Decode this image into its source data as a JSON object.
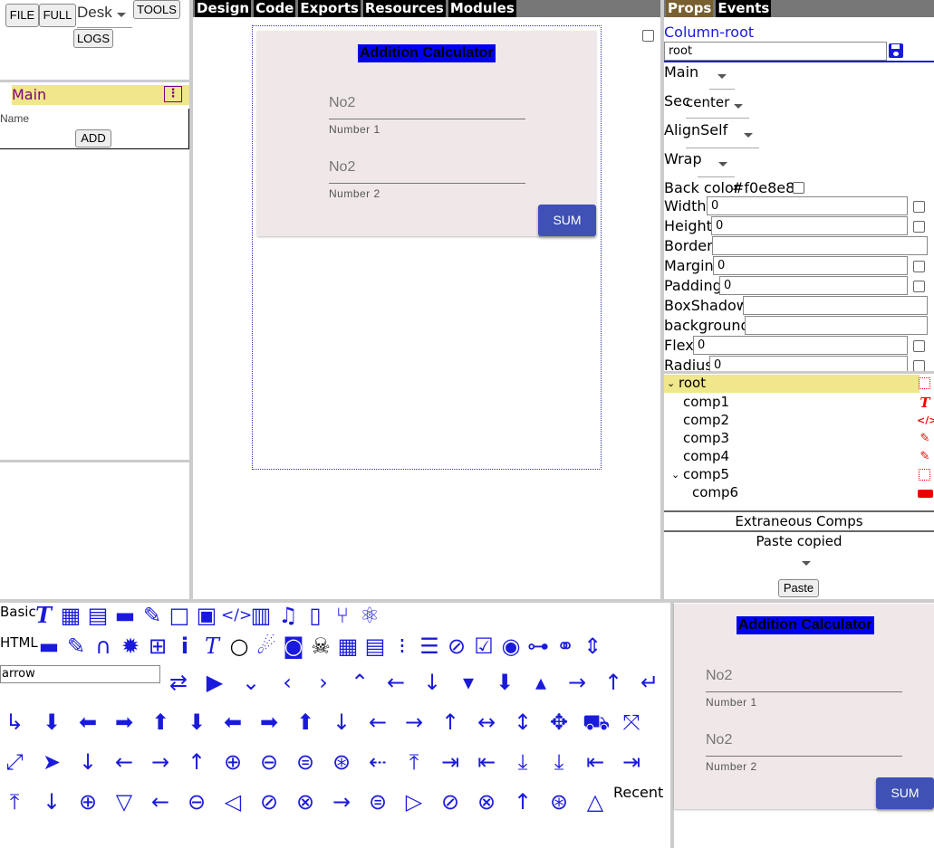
{
  "toolbar": {
    "file_label": "FILE",
    "full_label": "FULL",
    "device_select": "Desk",
    "tools_label": "TOOLS",
    "logs_label": "LOGS"
  },
  "left_panel": {
    "page_title": "Main",
    "name_label": "Name",
    "add_label": "ADD"
  },
  "center_tabs": [
    "Design",
    "Code",
    "Exports",
    "Resources",
    "Modules"
  ],
  "right_tabs": [
    "Props",
    "Events"
  ],
  "preview": {
    "title": "Addition Calculator",
    "field1_value": "No2",
    "field1_help": "Number 1",
    "field2_value": "No2",
    "field2_help": "Number 2",
    "sum_label": "SUM",
    "background": "#f0e8e8"
  },
  "props": {
    "component_title": "Column-root",
    "name_value": "root",
    "main_label": "Main",
    "sec_label": "Sec",
    "sec_value": "center",
    "alignself_label": "AlignSelf",
    "wrap_label": "Wrap",
    "backcolor_label": "Back color",
    "backcolor_value": "#f0e8e8",
    "width_label": "Width",
    "width_value": "0",
    "height_label": "Height",
    "height_value": "0",
    "border_label": "Border",
    "margin_label": "Margin",
    "margin_value": "0",
    "padding_label": "Padding",
    "padding_value": "0",
    "boxshadow_label": "BoxShadow",
    "background_label": "background",
    "flex_label": "Flex",
    "flex_value": "0",
    "radius_label": "Radius",
    "radius_value": "0"
  },
  "tree": {
    "root": "root",
    "comp1": "comp1",
    "comp2": "comp2",
    "comp3": "comp3",
    "comp4": "comp4",
    "comp5": "comp5",
    "comp6": "comp6"
  },
  "tree_footer": {
    "extraneous": "Extraneous Comps",
    "paste_copied": "Paste copied",
    "paste_label": "Paste"
  },
  "palette": {
    "basic_label": "Basic",
    "html_label": "HTML",
    "search_value": "arrow",
    "recent_label": "Recent"
  },
  "colors": {
    "accent_blue": "#1a1adc",
    "sum_button": "#3f51b5",
    "tab_bar": "#777777",
    "highlight": "#f0e68c",
    "icon_red": "#e00000"
  }
}
